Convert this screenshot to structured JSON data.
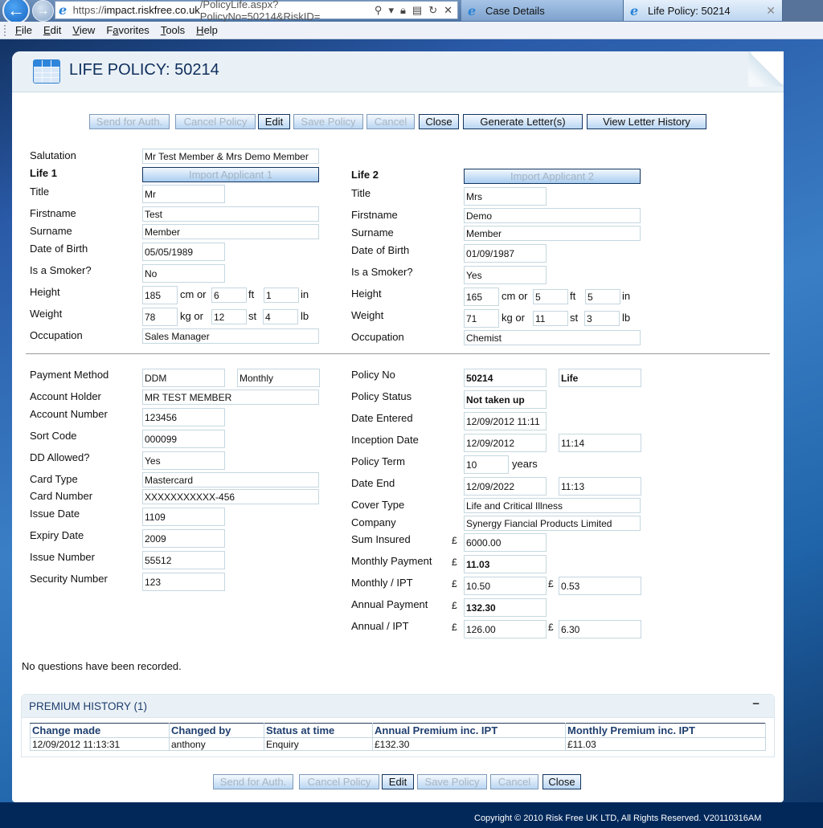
{
  "browser": {
    "url_prefix": "https://",
    "url_host": "impact.riskfree.co.uk",
    "url_path": "/PolicyLife.aspx?PolicyNo=50214&RiskID=",
    "tabs": [
      {
        "label": "Case Details",
        "active": false
      },
      {
        "label": "Life Policy: 50214",
        "active": true
      }
    ],
    "menu": [
      {
        "label": "File",
        "accel": "F",
        "rest": "ile"
      },
      {
        "label": "Edit",
        "accel": "E",
        "rest": "dit"
      },
      {
        "label": "View",
        "accel": "V",
        "rest": "iew"
      },
      {
        "label": "Favorites",
        "accel": "a",
        "pre": "F",
        "rest": "vorites"
      },
      {
        "label": "Tools",
        "accel": "T",
        "rest": "ools"
      },
      {
        "label": "Help",
        "accel": "H",
        "rest": "elp"
      }
    ]
  },
  "page": {
    "title": "LIFE POLICY: 50214",
    "actions": {
      "send_for_auth": "Send for Auth.",
      "cancel_policy": "Cancel Policy",
      "edit": "Edit",
      "save_policy": "Save Policy",
      "cancel": "Cancel",
      "close": "Close",
      "generate_letters": "Generate Letter(s)",
      "view_letter_history": "View Letter History"
    },
    "salutation": {
      "label": "Salutation",
      "value": "Mr Test Member & Mrs Demo Member"
    },
    "labels": {
      "title": "Title",
      "firstname": "Firstname",
      "surname": "Surname",
      "dob": "Date of Birth",
      "smoker": "Is a Smoker?",
      "height": "Height",
      "weight": "Weight",
      "occupation": "Occupation",
      "cm_or": "cm or",
      "ft": "ft",
      "in": "in",
      "kg_or": "kg or",
      "st": "st",
      "lb": "lb"
    },
    "life1": {
      "heading": "Life 1",
      "import_label": "Import Applicant 1",
      "title": "Mr",
      "firstname": "Test",
      "surname": "Member",
      "dob": "05/05/1989",
      "smoker": "No",
      "height_cm": "185",
      "height_ft": "6",
      "height_in": "1",
      "weight_kg": "78",
      "weight_st": "12",
      "weight_lb": "4",
      "occupation": "Sales Manager"
    },
    "life2": {
      "heading": "Life 2",
      "import_label": "Import Applicant 2",
      "title": "Mrs",
      "firstname": "Demo",
      "surname": "Member",
      "dob": "01/09/1987",
      "smoker": "Yes",
      "height_cm": "165",
      "height_ft": "5",
      "height_in": "5",
      "weight_kg": "71",
      "weight_st": "11",
      "weight_lb": "3",
      "occupation": "Chemist"
    },
    "payment": {
      "method_label": "Payment Method",
      "method": "DDM",
      "frequency": "Monthly",
      "holder_label": "Account Holder",
      "holder": "MR TEST MEMBER",
      "account_label": "Account Number",
      "account": "123456",
      "sort_label": "Sort Code",
      "sort": "000099",
      "dd_label": "DD Allowed?",
      "dd": "Yes",
      "card_type_label": "Card Type",
      "card_type": "Mastercard",
      "card_number_label": "Card Number",
      "card_number": "XXXXXXXXXXX-456",
      "issue_date_label": "Issue Date",
      "issue_date": "1109",
      "expiry_label": "Expiry Date",
      "expiry": "2009",
      "issue_number_label": "Issue Number",
      "issue_number": "55512",
      "security_label": "Security Number",
      "security": "123"
    },
    "policy": {
      "no_label": "Policy No",
      "no": "50214",
      "type": "Life",
      "status_label": "Policy Status",
      "status": "Not taken up",
      "entered_label": "Date Entered",
      "entered": "12/09/2012 11:11",
      "inception_label": "Inception Date",
      "inception_date": "12/09/2012",
      "inception_time": "11:14",
      "term_label": "Policy Term",
      "term": "10",
      "term_unit": "years",
      "end_label": "Date End",
      "end_date": "12/09/2022",
      "end_time": "11:13",
      "cover_label": "Cover Type",
      "cover": "Life and Critical Illness",
      "company_label": "Company",
      "company": "Synergy Fiancial Products Limited",
      "currency": "£",
      "sum_label": "Sum Insured",
      "sum": "6000.00",
      "monthly_label": "Monthly Payment",
      "monthly": "11.03",
      "monthly_ipt_label": "Monthly / IPT",
      "monthly_net": "10.50",
      "monthly_ipt": "0.53",
      "annual_label": "Annual Payment",
      "annual": "132.30",
      "annual_ipt_label": "Annual / IPT",
      "annual_net": "126.00",
      "annual_ipt": "6.30"
    },
    "no_questions": "No questions have been recorded.",
    "premium_history": {
      "title": "PREMIUM HISTORY (1)",
      "collapse_symbol": "−",
      "columns": [
        "Change made",
        "Changed by",
        "Status at time",
        "Annual Premium inc. IPT",
        "Monthly Premium inc. IPT"
      ],
      "rows": [
        [
          "12/09/2012 11:13:31",
          "anthony",
          "Enquiry",
          "£132.30",
          "£11.03"
        ]
      ]
    }
  },
  "footer": {
    "copyright": "Copyright © 2010 Risk Free UK LTD, All Rights Reserved. V20110316AM"
  }
}
